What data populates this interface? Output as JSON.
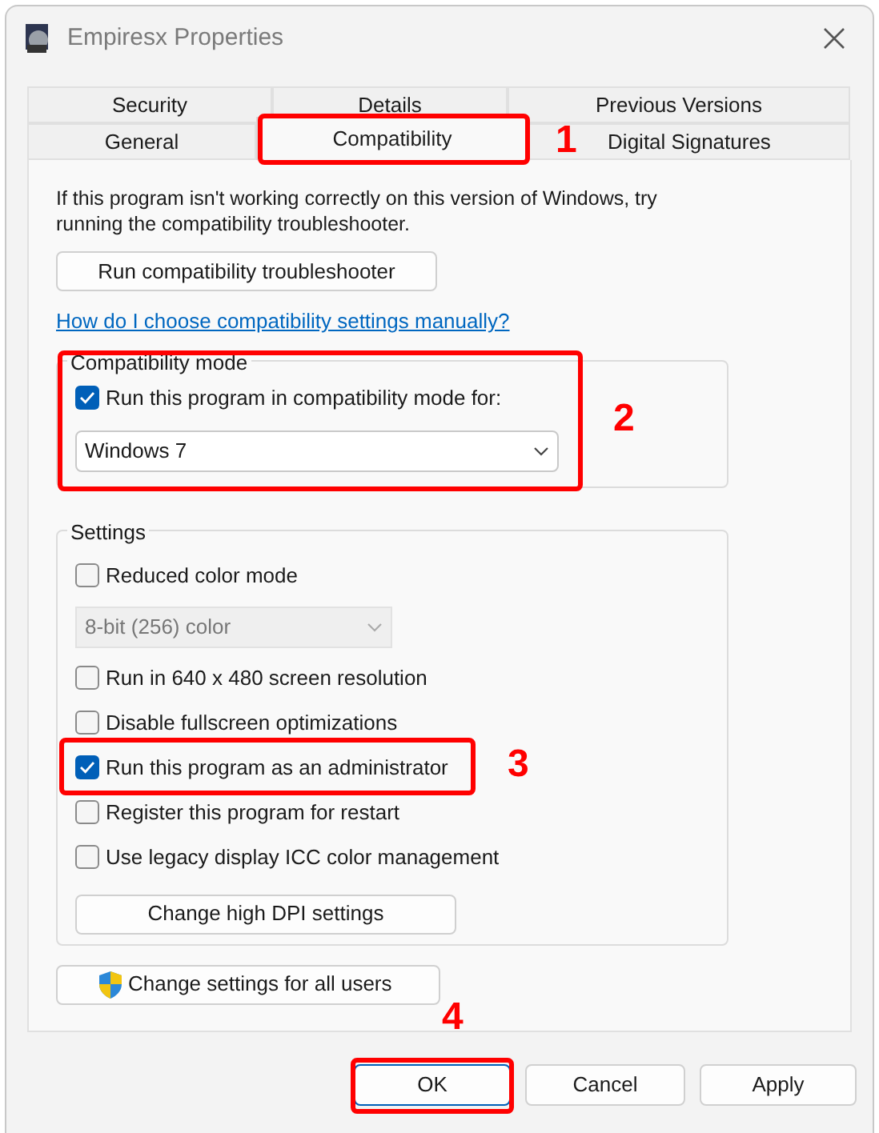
{
  "window": {
    "title": "Empiresx Properties"
  },
  "tab_rows": [
    [
      {
        "label": "Security",
        "selected": false
      },
      {
        "label": "Details",
        "selected": false
      },
      {
        "label": "Previous Versions",
        "selected": false
      }
    ],
    [
      {
        "label": "General",
        "selected": false
      },
      {
        "label": "Compatibility",
        "selected": true
      },
      {
        "label": "Digital Signatures",
        "selected": false
      }
    ]
  ],
  "intro": "If this program isn't working correctly on this version of Windows, try running the compatibility troubleshooter.",
  "troubleshooter_button": "Run compatibility troubleshooter",
  "help_link": "How do I choose compatibility settings manually?",
  "compatibility_mode": {
    "title": "Compatibility mode",
    "checkbox": {
      "label": "Run this program in compatibility mode for:",
      "checked": true
    },
    "dropdown": {
      "value": "Windows 7",
      "disabled": false
    }
  },
  "settings": {
    "title": "Settings",
    "items": [
      {
        "kind": "checkbox",
        "label": "Reduced color mode",
        "checked": false
      },
      {
        "kind": "dropdown",
        "value": "8-bit (256) color",
        "disabled": true
      },
      {
        "kind": "checkbox",
        "label": "Run in 640 x 480 screen resolution",
        "checked": false
      },
      {
        "kind": "checkbox",
        "label": "Disable fullscreen optimizations",
        "checked": false
      },
      {
        "kind": "checkbox",
        "label": "Run this program as an administrator",
        "checked": true
      },
      {
        "kind": "checkbox",
        "label": "Register this program for restart",
        "checked": false
      },
      {
        "kind": "checkbox",
        "label": "Use legacy display ICC color management",
        "checked": false
      },
      {
        "kind": "button",
        "label": "Change high DPI settings"
      }
    ]
  },
  "all_users_button": "Change settings for all users",
  "buttons": [
    "OK",
    "Cancel",
    "Apply"
  ],
  "annotations": [
    {
      "label": "1"
    },
    {
      "label": "2"
    },
    {
      "label": "3"
    },
    {
      "label": "4"
    }
  ]
}
